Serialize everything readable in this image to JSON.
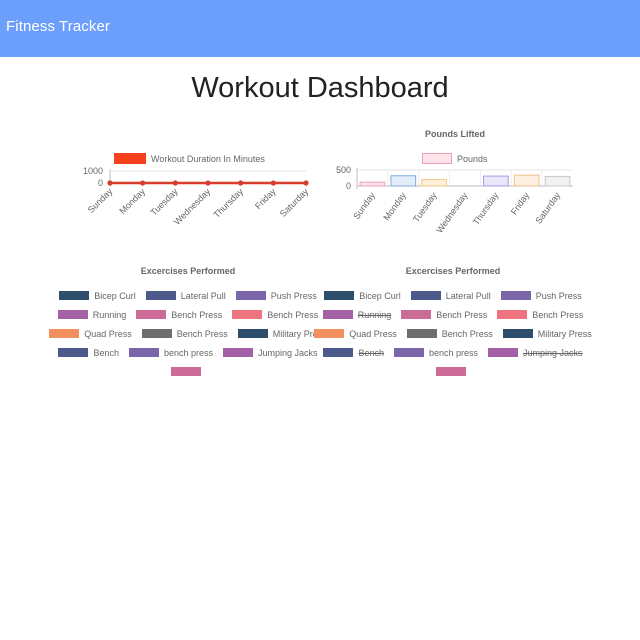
{
  "navbar": {
    "brand": "Fitness Tracker",
    "color": "#6c9ffb"
  },
  "page": {
    "title": "Workout Dashboard"
  },
  "charts": {
    "duration": {
      "legend_label": "Workout Duration In Minutes",
      "legend_color": "#f5421d",
      "line_color": "#d73c2c"
    },
    "pounds": {
      "title": "Pounds Lifted",
      "legend_label": "Pounds"
    },
    "exercises_left": {
      "title": "Excercises Performed",
      "legend": [
        {
          "label": "Bicep Curl",
          "color": "#2e4f6b",
          "hidden": false
        },
        {
          "label": "Lateral Pull",
          "color": "#4b5a8a",
          "hidden": false
        },
        {
          "label": "Push Press",
          "color": "#7a66a8",
          "hidden": false
        },
        {
          "label": "Running",
          "color": "#a561a6",
          "hidden": false
        },
        {
          "label": "Bench Press",
          "color": "#cc6a98",
          "hidden": false
        },
        {
          "label": "Bench Press",
          "color": "#ee7480",
          "hidden": false
        },
        {
          "label": "Quad Press",
          "color": "#f2915e",
          "hidden": false
        },
        {
          "label": "Bench Press",
          "color": "#6e6e6e",
          "hidden": false
        },
        {
          "label": "Military Press",
          "color": "#2e4f6b",
          "hidden": false
        },
        {
          "label": "Bench",
          "color": "#4b5a8a",
          "hidden": false
        },
        {
          "label": "bench press",
          "color": "#7a66a8",
          "hidden": false
        },
        {
          "label": "Jumping Jacks",
          "color": "#a561a6",
          "hidden": false
        },
        {
          "label": "",
          "color": "#cc6a98",
          "hidden": false
        }
      ]
    },
    "exercises_right": {
      "title": "Excercises Performed",
      "legend": [
        {
          "label": "Bicep Curl",
          "color": "#2e4f6b",
          "hidden": false
        },
        {
          "label": "Lateral Pull",
          "color": "#4b5a8a",
          "hidden": false
        },
        {
          "label": "Push Press",
          "color": "#7a66a8",
          "hidden": false
        },
        {
          "label": "Running",
          "color": "#a561a6",
          "hidden": true
        },
        {
          "label": "Bench Press",
          "color": "#cc6a98",
          "hidden": false
        },
        {
          "label": "Bench Press",
          "color": "#ee7480",
          "hidden": false
        },
        {
          "label": "Quad Press",
          "color": "#f2915e",
          "hidden": false
        },
        {
          "label": "Bench Press",
          "color": "#6e6e6e",
          "hidden": false
        },
        {
          "label": "Military Press",
          "color": "#2e4f6b",
          "hidden": false
        },
        {
          "label": "Bench",
          "color": "#4b5a8a",
          "hidden": true
        },
        {
          "label": "bench press",
          "color": "#7a66a8",
          "hidden": false
        },
        {
          "label": "Jumping Jacks",
          "color": "#a561a6",
          "hidden": true
        },
        {
          "label": "",
          "color": "#cc6a98",
          "hidden": false
        }
      ]
    }
  },
  "chart_data": [
    {
      "type": "line",
      "categories": [
        "Sunday",
        "Monday",
        "Tuesday",
        "Wednesday",
        "Thursday",
        "Friday",
        "Saturday"
      ],
      "series": [
        {
          "name": "Workout Duration In Minutes",
          "values": [
            0,
            0,
            0,
            0,
            0,
            0,
            0
          ],
          "color": "#d73c2c"
        }
      ],
      "yticks": [
        "1000",
        "0"
      ],
      "ylim": [
        0,
        1000
      ],
      "legend": "top"
    },
    {
      "type": "bar",
      "title": "Pounds Lifted",
      "categories": [
        "Sunday",
        "Monday",
        "Tuesday",
        "Wednesday",
        "Thursday",
        "Friday",
        "Saturday"
      ],
      "series": [
        {
          "name": "Pounds",
          "values": [
            120,
            320,
            200,
            0,
            310,
            340,
            300
          ]
        }
      ],
      "bar_fills": [
        "#fde4ea",
        "#e3edfa",
        "#fdf0dc",
        "#e6f5f5",
        "#ebe7fa",
        "#fdf0e2",
        "#f1f1f1"
      ],
      "bar_strokes": [
        "#f0a0b4",
        "#80abe0",
        "#f2c887",
        "#8fd3d3",
        "#a99ae6",
        "#f2bf87",
        "#c8c8c8"
      ],
      "yticks": [
        "500",
        "0"
      ],
      "ylim": [
        0,
        500
      ],
      "legend": "top"
    }
  ]
}
